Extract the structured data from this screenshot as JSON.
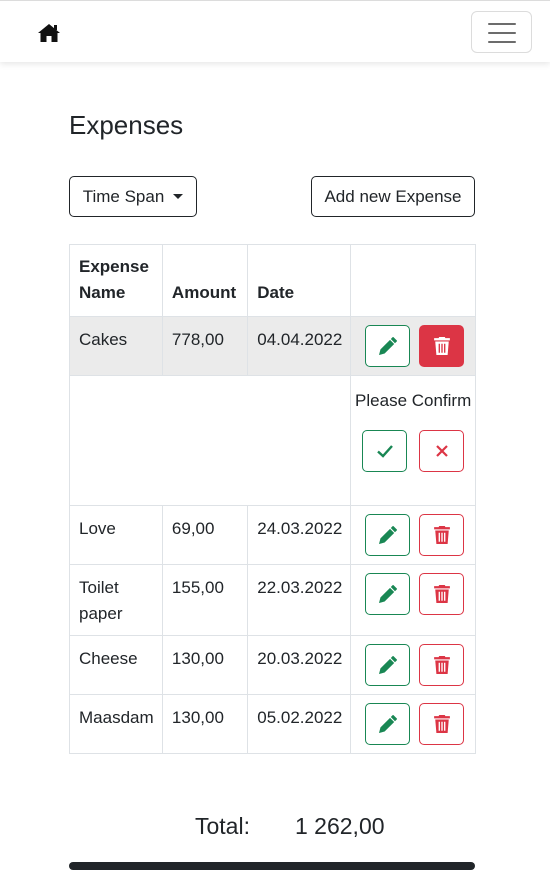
{
  "header": {
    "home_icon": "home-icon",
    "menu_icon": "hamburger-menu-icon"
  },
  "page": {
    "title": "Expenses"
  },
  "toolbar": {
    "time_span_label": "Time Span",
    "add_label": "Add new Expense"
  },
  "table": {
    "columns": [
      "Expense Name",
      "Amount",
      "Date",
      ""
    ],
    "rows": [
      {
        "name": "Cakes",
        "amount": "778,00",
        "date": "04.04.2022",
        "selected": true
      },
      {
        "name": "Love",
        "amount": "69,00",
        "date": "24.03.2022"
      },
      {
        "name": "Toilet paper",
        "amount": "155,00",
        "date": "22.03.2022"
      },
      {
        "name": "Cheese",
        "amount": "130,00",
        "date": "20.03.2022"
      },
      {
        "name": "Maasdam",
        "amount": "130,00",
        "date": "05.02.2022"
      }
    ],
    "confirm": {
      "text": "Please Confirm",
      "confirm_icon": "check-icon",
      "cancel_icon": "x-icon"
    },
    "row_action_icons": {
      "edit": "pencil-icon",
      "delete": "trash-icon"
    }
  },
  "footer": {
    "total_label": "Total:",
    "total_value": "1 262,00"
  },
  "colors": {
    "success": "#198754",
    "danger": "#dc3545",
    "dark": "#212529",
    "highlight": "#ebebeb"
  }
}
